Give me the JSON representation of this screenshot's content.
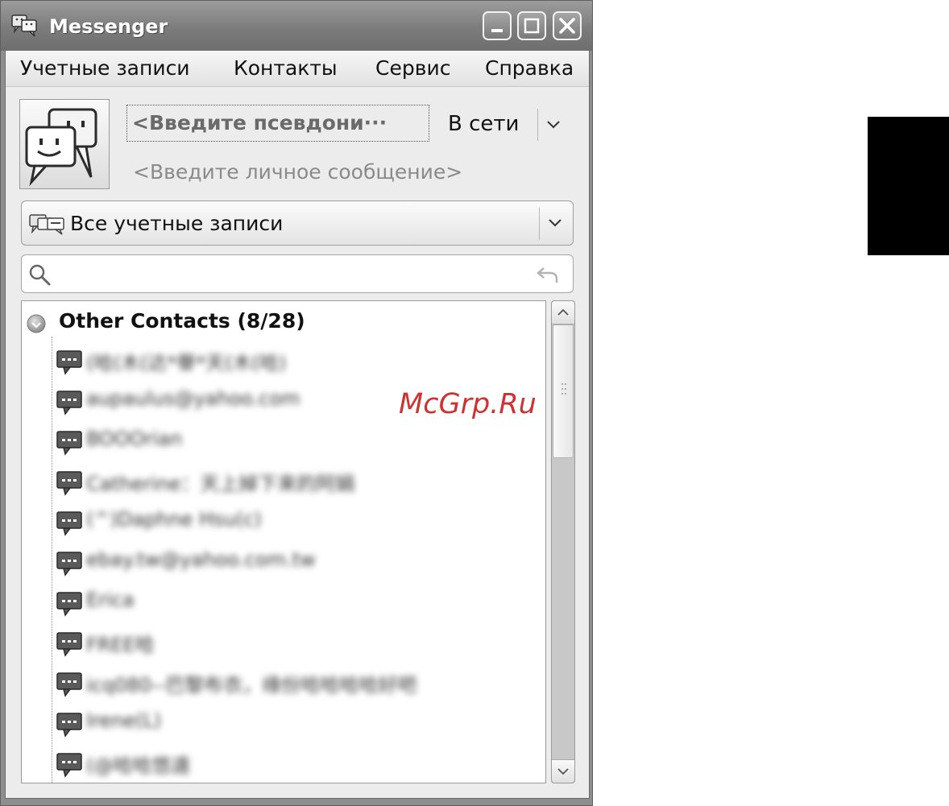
{
  "window": {
    "title": "Messenger",
    "icon": "messenger-icon",
    "controls": [
      "minimize",
      "maximize",
      "close"
    ]
  },
  "menu": {
    "items": [
      "Учетные записи",
      "Контакты",
      "Сервис",
      "Справка"
    ]
  },
  "profile": {
    "nickname_placeholder": "<Введите псевдони···",
    "status": "В сети",
    "personal_message_placeholder": "<Введите личное сообщение>"
  },
  "accounts_combo": {
    "selected": "Все учетные записи",
    "icon": "accounts-icon"
  },
  "search": {
    "value": "",
    "icon": "search-icon",
    "clear_icon": "undo-clear-icon"
  },
  "contacts": {
    "group": "Other Contacts (8/28)",
    "items": [
      "(哈(木(达*譽*天(木(哈)",
      "aupaulus@yahoo.com",
      "BOOOrian",
      "Catherine：天上掉下来的阿娟",
      "(^)Daphne Hsu(c)",
      "ebay.tw@yahoo.com.tw",
      "Erica",
      "FREE哈",
      "icq080--巴黎布衣，缘份哈哈哈哈好吧",
      "Irene(L)",
      "(@哈哈悠遠"
    ]
  },
  "watermark": "McGrp.Ru",
  "colors": {
    "watermark": "#cc3333",
    "titlebar": "#7c7c7c",
    "window_bg": "#ececec"
  }
}
